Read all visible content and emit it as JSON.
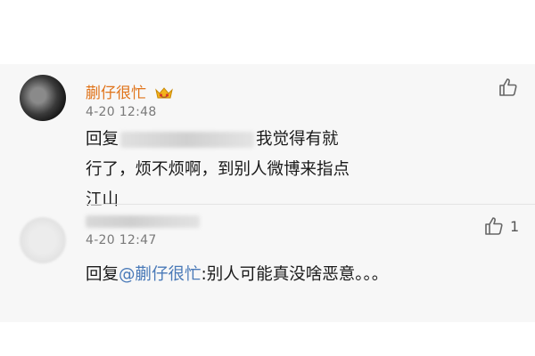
{
  "comments": [
    {
      "username": "蒯仔很忙",
      "badge_icon": "crown-emoji-icon",
      "time": "4-20 12:48",
      "reply_prefix": "回复",
      "text": "我觉得有就行了，烦不烦啊，到别人微博来指点江山",
      "like_count": ""
    },
    {
      "username": "",
      "time": "4-20 12:47",
      "reply_prefix": "回复",
      "mention": "@蒯仔很忙",
      "text": ":别人可能真没啥恶意。。。",
      "like_count": "1"
    }
  ],
  "icons": {
    "like": "thumbs-up-icon"
  },
  "colors": {
    "username": "#e0741b",
    "mention": "#4a7ab8",
    "timestamp": "#7a7a7a",
    "panel_bg": "#f7f7f7"
  }
}
